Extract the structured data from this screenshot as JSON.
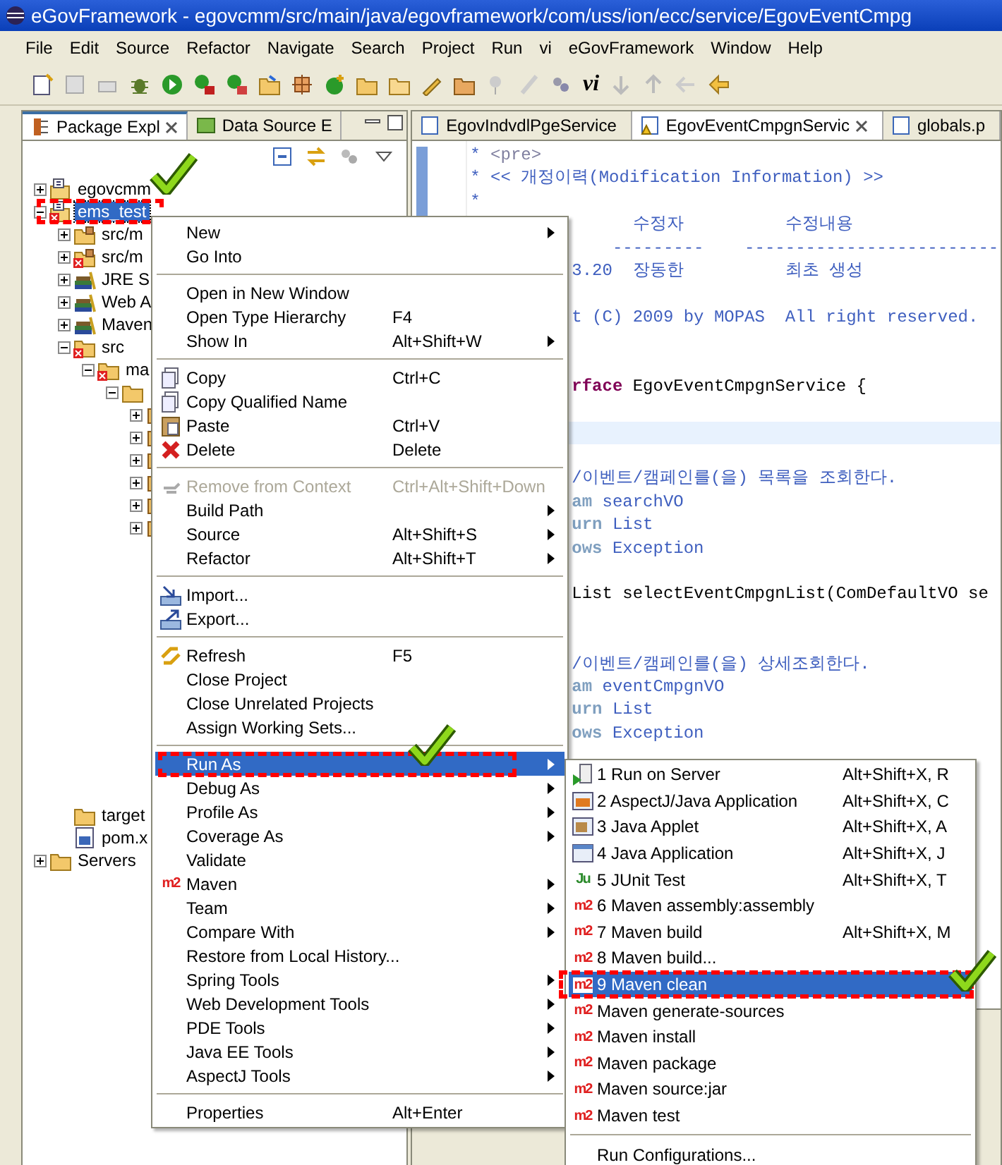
{
  "window": {
    "title": "eGovFramework - egovcmm/src/main/java/egovframework/com/uss/ion/ecc/service/EgovEventCmpg"
  },
  "menu_bar": [
    "File",
    "Edit",
    "Source",
    "Refactor",
    "Navigate",
    "Search",
    "Project",
    "Run",
    "vi",
    "eGovFramework",
    "Window",
    "Help"
  ],
  "toolbar": {
    "logo_text": "vi"
  },
  "left_panel": {
    "tabs": [
      {
        "label": "Package Expl",
        "selected": true
      },
      {
        "label": "Data Source E",
        "selected": false
      }
    ],
    "tree": [
      {
        "label": "egovcmm",
        "kind": "project",
        "expanded": false,
        "selected": false,
        "error": false
      },
      {
        "label": "ems_test",
        "kind": "project",
        "expanded": true,
        "selected": true,
        "error": true,
        "children": [
          {
            "label": "src/m",
            "kind": "sourcefolder",
            "expanded": false,
            "selected": false,
            "error": false
          },
          {
            "label": "src/m",
            "kind": "sourcefolder",
            "expanded": false,
            "selected": false,
            "error": true
          },
          {
            "label": "JRE S",
            "kind": "library",
            "expanded": false,
            "selected": false,
            "error": false
          },
          {
            "label": "Web A",
            "kind": "library",
            "expanded": false,
            "selected": false,
            "error": false
          },
          {
            "label": "Maven",
            "kind": "library",
            "expanded": false,
            "selected": false,
            "error": false
          },
          {
            "label": "src",
            "kind": "folder",
            "expanded": true,
            "selected": false,
            "error": true,
            "children": [
              {
                "label": "ma",
                "kind": "folder",
                "expanded": true,
                "selected": false,
                "error": true,
                "children": [
                  {
                    "kind": "folder",
                    "expanded": true,
                    "children": [
                      {
                        "kind": "package",
                        "expanded": false
                      },
                      {
                        "kind": "package",
                        "expanded": false
                      },
                      {
                        "kind": "package",
                        "expanded": false
                      },
                      {
                        "kind": "package",
                        "expanded": false
                      },
                      {
                        "kind": "package",
                        "expanded": false
                      },
                      {
                        "kind": "package",
                        "expanded": false
                      }
                    ]
                  }
                ]
              }
            ]
          },
          {
            "label": "target",
            "kind": "folder",
            "selected": false,
            "error": false
          },
          {
            "label": "pom.x",
            "kind": "file",
            "selected": false,
            "error": false
          }
        ]
      },
      {
        "label": "Servers",
        "kind": "folder",
        "expanded": false,
        "selected": false,
        "error": false
      }
    ]
  },
  "editor": {
    "tabs": [
      {
        "label": "EgovIndvdlPgeService",
        "selected": false,
        "warning": false
      },
      {
        "label": "EgovEventCmpgnServic",
        "selected": true,
        "warning": true
      },
      {
        "label": "globals.p",
        "selected": false,
        "warning": false
      }
    ],
    "lines": [
      {
        "kind": "full",
        "segments": [
          {
            "text": "* ",
            "kind": "doc"
          },
          {
            "text": "<pre>",
            "kind": "tag"
          }
        ]
      },
      {
        "kind": "full",
        "segments": [
          {
            "text": "* << 개정이력(Modification Information) >>",
            "kind": "doc"
          }
        ]
      },
      {
        "kind": "full",
        "segments": [
          {
            "text": "*",
            "kind": "doc"
          }
        ]
      },
      {
        "kind": "clipped",
        "segments": [
          {
            "text": "      수정자          수정내용",
            "kind": "doc"
          }
        ]
      },
      {
        "kind": "clipped",
        "segments": [
          {
            "text": "    ---------    -------------------------",
            "kind": "doc"
          }
        ]
      },
      {
        "kind": "clipped",
        "segments": [
          {
            "text": "3.20  장동한          최초 생성",
            "kind": "doc"
          }
        ]
      },
      {
        "kind": "blank"
      },
      {
        "kind": "clipped",
        "segments": [
          {
            "text": "t (C) 2009 by MOPAS  All right reserved.",
            "kind": "doc"
          }
        ]
      },
      {
        "kind": "blank"
      },
      {
        "kind": "blank"
      },
      {
        "kind": "clipped",
        "segments": [
          {
            "text": "rface",
            "kind": "keyword"
          },
          {
            "text": " EgovEventCmpgnService {",
            "kind": "plain"
          }
        ]
      },
      {
        "kind": "blank"
      },
      {
        "kind": "current"
      },
      {
        "kind": "blank"
      },
      {
        "kind": "clipped",
        "segments": [
          {
            "text": "/이벤트/캠페인를(을) 목록을 조회한다.",
            "kind": "doc"
          }
        ]
      },
      {
        "kind": "clipped",
        "segments": [
          {
            "text": "am",
            "kind": "doctag"
          },
          {
            "text": " searchVO",
            "kind": "doc"
          }
        ]
      },
      {
        "kind": "clipped",
        "segments": [
          {
            "text": "urn",
            "kind": "doctag"
          },
          {
            "text": " List",
            "kind": "doc"
          }
        ]
      },
      {
        "kind": "clipped",
        "segments": [
          {
            "text": "ows",
            "kind": "doctag"
          },
          {
            "text": " Exception",
            "kind": "doc"
          }
        ]
      },
      {
        "kind": "blank"
      },
      {
        "kind": "clipped",
        "segments": [
          {
            "text": "List selectEventCmpgnList(ComDefaultVO se",
            "kind": "plain"
          }
        ]
      },
      {
        "kind": "blank"
      },
      {
        "kind": "blank"
      },
      {
        "kind": "clipped",
        "segments": [
          {
            "text": "/이벤트/캠페인를(을) 상세조회한다.",
            "kind": "doc"
          }
        ]
      },
      {
        "kind": "clipped",
        "segments": [
          {
            "text": "am",
            "kind": "doctag"
          },
          {
            "text": " eventCmpgnVO",
            "kind": "doc"
          }
        ]
      },
      {
        "kind": "clipped",
        "segments": [
          {
            "text": "urn",
            "kind": "doctag"
          },
          {
            "text": " List",
            "kind": "doc"
          }
        ]
      },
      {
        "kind": "clipped",
        "segments": [
          {
            "text": "ows",
            "kind": "doctag"
          },
          {
            "text": " Exception",
            "kind": "doc"
          }
        ]
      }
    ]
  },
  "context_menu": {
    "items": [
      {
        "kind": "plain",
        "label": "New",
        "submenu": true,
        "selected": false,
        "disabled": false
      },
      {
        "kind": "plain",
        "label": "Go Into",
        "submenu": false,
        "selected": false,
        "disabled": false
      },
      {
        "kind": "separator"
      },
      {
        "kind": "plain",
        "label": "Open in New Window",
        "submenu": false,
        "selected": false,
        "disabled": false
      },
      {
        "kind": "plain",
        "label": "Open Type Hierarchy",
        "shortcut": "F4",
        "submenu": false,
        "selected": false,
        "disabled": false
      },
      {
        "kind": "plain",
        "label": "Show In",
        "shortcut": "Alt+Shift+W",
        "submenu": true,
        "selected": false,
        "disabled": false
      },
      {
        "kind": "separator"
      },
      {
        "kind": "copy",
        "label": "Copy",
        "shortcut": "Ctrl+C",
        "submenu": false,
        "selected": false,
        "disabled": false
      },
      {
        "kind": "copy",
        "label": "Copy Qualified Name",
        "submenu": false,
        "selected": false,
        "disabled": false
      },
      {
        "kind": "paste",
        "label": "Paste",
        "shortcut": "Ctrl+V",
        "submenu": false,
        "selected": false,
        "disabled": false
      },
      {
        "kind": "delete",
        "label": "Delete",
        "shortcut": "Delete",
        "submenu": false,
        "selected": false,
        "disabled": false
      },
      {
        "kind": "separator"
      },
      {
        "kind": "remove",
        "label": "Remove from Context",
        "shortcut": "Ctrl+Alt+Shift+Down",
        "submenu": false,
        "selected": false,
        "disabled": true
      },
      {
        "kind": "plain",
        "label": "Build Path",
        "submenu": true,
        "selected": false,
        "disabled": false
      },
      {
        "kind": "plain",
        "label": "Source",
        "shortcut": "Alt+Shift+S",
        "submenu": true,
        "selected": false,
        "disabled": false
      },
      {
        "kind": "plain",
        "label": "Refactor",
        "shortcut": "Alt+Shift+T",
        "submenu": true,
        "selected": false,
        "disabled": false
      },
      {
        "kind": "separator"
      },
      {
        "kind": "import",
        "label": "Import...",
        "submenu": false,
        "selected": false,
        "disabled": false
      },
      {
        "kind": "export",
        "label": "Export...",
        "submenu": false,
        "selected": false,
        "disabled": false
      },
      {
        "kind": "separator"
      },
      {
        "kind": "refresh",
        "label": "Refresh",
        "shortcut": "F5",
        "submenu": false,
        "selected": false,
        "disabled": false
      },
      {
        "kind": "plain",
        "label": "Close Project",
        "submenu": false,
        "selected": false,
        "disabled": false
      },
      {
        "kind": "plain",
        "label": "Close Unrelated Projects",
        "submenu": false,
        "selected": false,
        "disabled": false
      },
      {
        "kind": "plain",
        "label": "Assign Working Sets...",
        "submenu": false,
        "selected": false,
        "disabled": false
      },
      {
        "kind": "separator"
      },
      {
        "kind": "plain",
        "label": "Run As",
        "submenu": true,
        "selected": true,
        "disabled": false
      },
      {
        "kind": "plain",
        "label": "Debug As",
        "submenu": true,
        "selected": false,
        "disabled": false
      },
      {
        "kind": "plain",
        "label": "Profile As",
        "submenu": true,
        "selected": false,
        "disabled": false
      },
      {
        "kind": "plain",
        "label": "Coverage As",
        "submenu": true,
        "selected": false,
        "disabled": false
      },
      {
        "kind": "plain",
        "label": "Validate",
        "submenu": false,
        "selected": false,
        "disabled": false
      },
      {
        "kind": "plain",
        "label": "Maven",
        "badge": "m2",
        "submenu": true,
        "selected": false,
        "disabled": false
      },
      {
        "kind": "plain",
        "label": "Team",
        "submenu": true,
        "selected": false,
        "disabled": false
      },
      {
        "kind": "plain",
        "label": "Compare With",
        "submenu": true,
        "selected": false,
        "disabled": false
      },
      {
        "kind": "plain",
        "label": "Restore from Local History...",
        "submenu": false,
        "selected": false,
        "disabled": false
      },
      {
        "kind": "plain",
        "label": "Spring Tools",
        "submenu": true,
        "selected": false,
        "disabled": false
      },
      {
        "kind": "plain",
        "label": "Web Development Tools",
        "submenu": true,
        "selected": false,
        "disabled": false
      },
      {
        "kind": "plain",
        "label": "PDE Tools",
        "submenu": true,
        "selected": false,
        "disabled": false
      },
      {
        "kind": "plain",
        "label": "Java EE Tools",
        "submenu": true,
        "selected": false,
        "disabled": false
      },
      {
        "kind": "plain",
        "label": "AspectJ Tools",
        "submenu": true,
        "selected": false,
        "disabled": false
      },
      {
        "kind": "separator"
      },
      {
        "kind": "plain",
        "label": "Properties",
        "shortcut": "Alt+Enter",
        "submenu": false,
        "selected": false,
        "disabled": false
      }
    ]
  },
  "run_as_menu": {
    "items": [
      {
        "kind": "server",
        "label": "1 Run on Server",
        "shortcut": "Alt+Shift+X, R",
        "selected": false
      },
      {
        "kind": "aj",
        "label": "2 AspectJ/Java Application",
        "shortcut": "Alt+Shift+X, C",
        "selected": false
      },
      {
        "kind": "applet",
        "label": "3 Java Applet",
        "shortcut": "Alt+Shift+X, A",
        "selected": false
      },
      {
        "kind": "java",
        "label": "4 Java Application",
        "shortcut": "Alt+Shift+X, J",
        "selected": false
      },
      {
        "kind": "junit",
        "label": "5 JUnit Test",
        "shortcut": "Alt+Shift+X, T",
        "badge": "Ju",
        "selected": false
      },
      {
        "kind": "maven",
        "label": "6 Maven assembly:assembly",
        "badge": "m2",
        "selected": false
      },
      {
        "kind": "maven",
        "label": "7 Maven build",
        "shortcut": "Alt+Shift+X, M",
        "badge": "m2",
        "selected": false
      },
      {
        "kind": "maven",
        "label": "8 Maven build...",
        "badge": "m2",
        "selected": false
      },
      {
        "kind": "maven",
        "label": "9 Maven clean",
        "badge": "m2",
        "selected": true
      },
      {
        "kind": "maven",
        "label": "Maven generate-sources",
        "badge": "m2",
        "selected": false
      },
      {
        "kind": "maven",
        "label": "Maven install",
        "badge": "m2",
        "selected": false
      },
      {
        "kind": "maven",
        "label": "Maven package",
        "badge": "m2",
        "selected": false
      },
      {
        "kind": "maven",
        "label": "Maven source:jar",
        "badge": "m2",
        "selected": false
      },
      {
        "kind": "maven",
        "label": "Maven test",
        "badge": "m2",
        "selected": false
      },
      {
        "kind": "separator"
      },
      {
        "kind": "plain",
        "label": "Run Configurations...",
        "selected": false
      }
    ]
  }
}
